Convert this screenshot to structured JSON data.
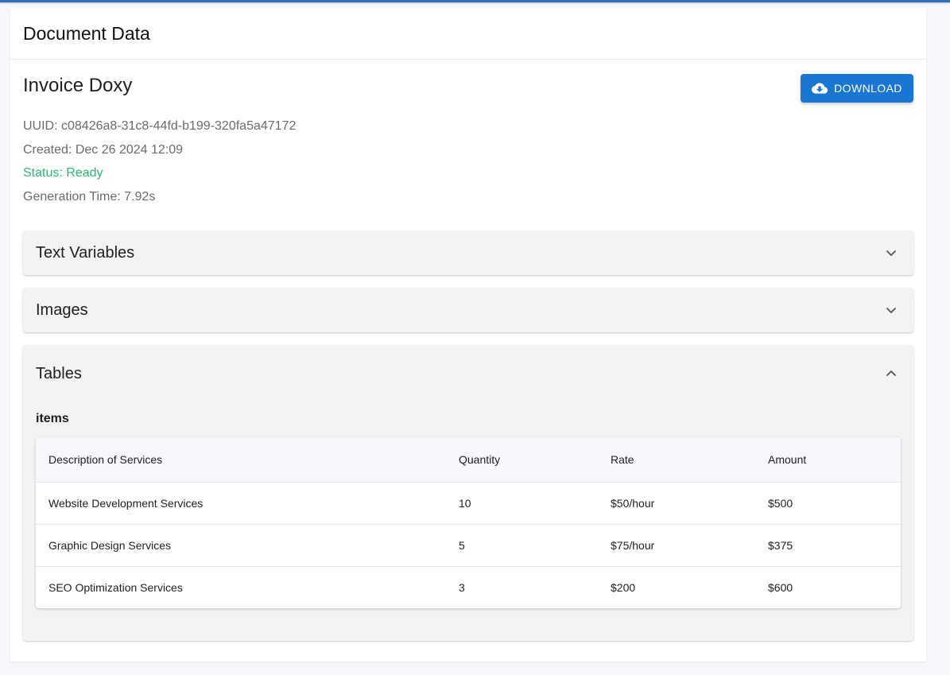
{
  "header": {
    "title": "Document Data"
  },
  "document": {
    "name": "Invoice Doxy",
    "download_label": "DOWNLOAD",
    "uuid": "UUID: c08426a8-31c8-44fd-b199-320fa5a47172",
    "created": "Created: Dec 26 2024 12:09",
    "status": "Status: Ready",
    "generation_time": "Generation Time: 7.92s"
  },
  "panels": {
    "text_variables": "Text Variables",
    "images": "Images",
    "tables": "Tables"
  },
  "table": {
    "label": "items",
    "columns": [
      "Description of Services",
      "Quantity",
      "Rate",
      "Amount"
    ],
    "rows": [
      [
        "Website Development Services",
        "10",
        "$50/hour",
        "$500"
      ],
      [
        "Graphic Design Services",
        "5",
        "$75/hour",
        "$375"
      ],
      [
        "SEO Optimization Services",
        "3",
        "$200",
        "$600"
      ]
    ]
  },
  "colors": {
    "accent": "#1976d2",
    "status_ready": "#2bb673",
    "top_bar": "#2e6fb8"
  },
  "icons": {
    "download": "cloud-download-icon",
    "collapse": "chevron-down-icon",
    "expand": "chevron-up-icon"
  }
}
